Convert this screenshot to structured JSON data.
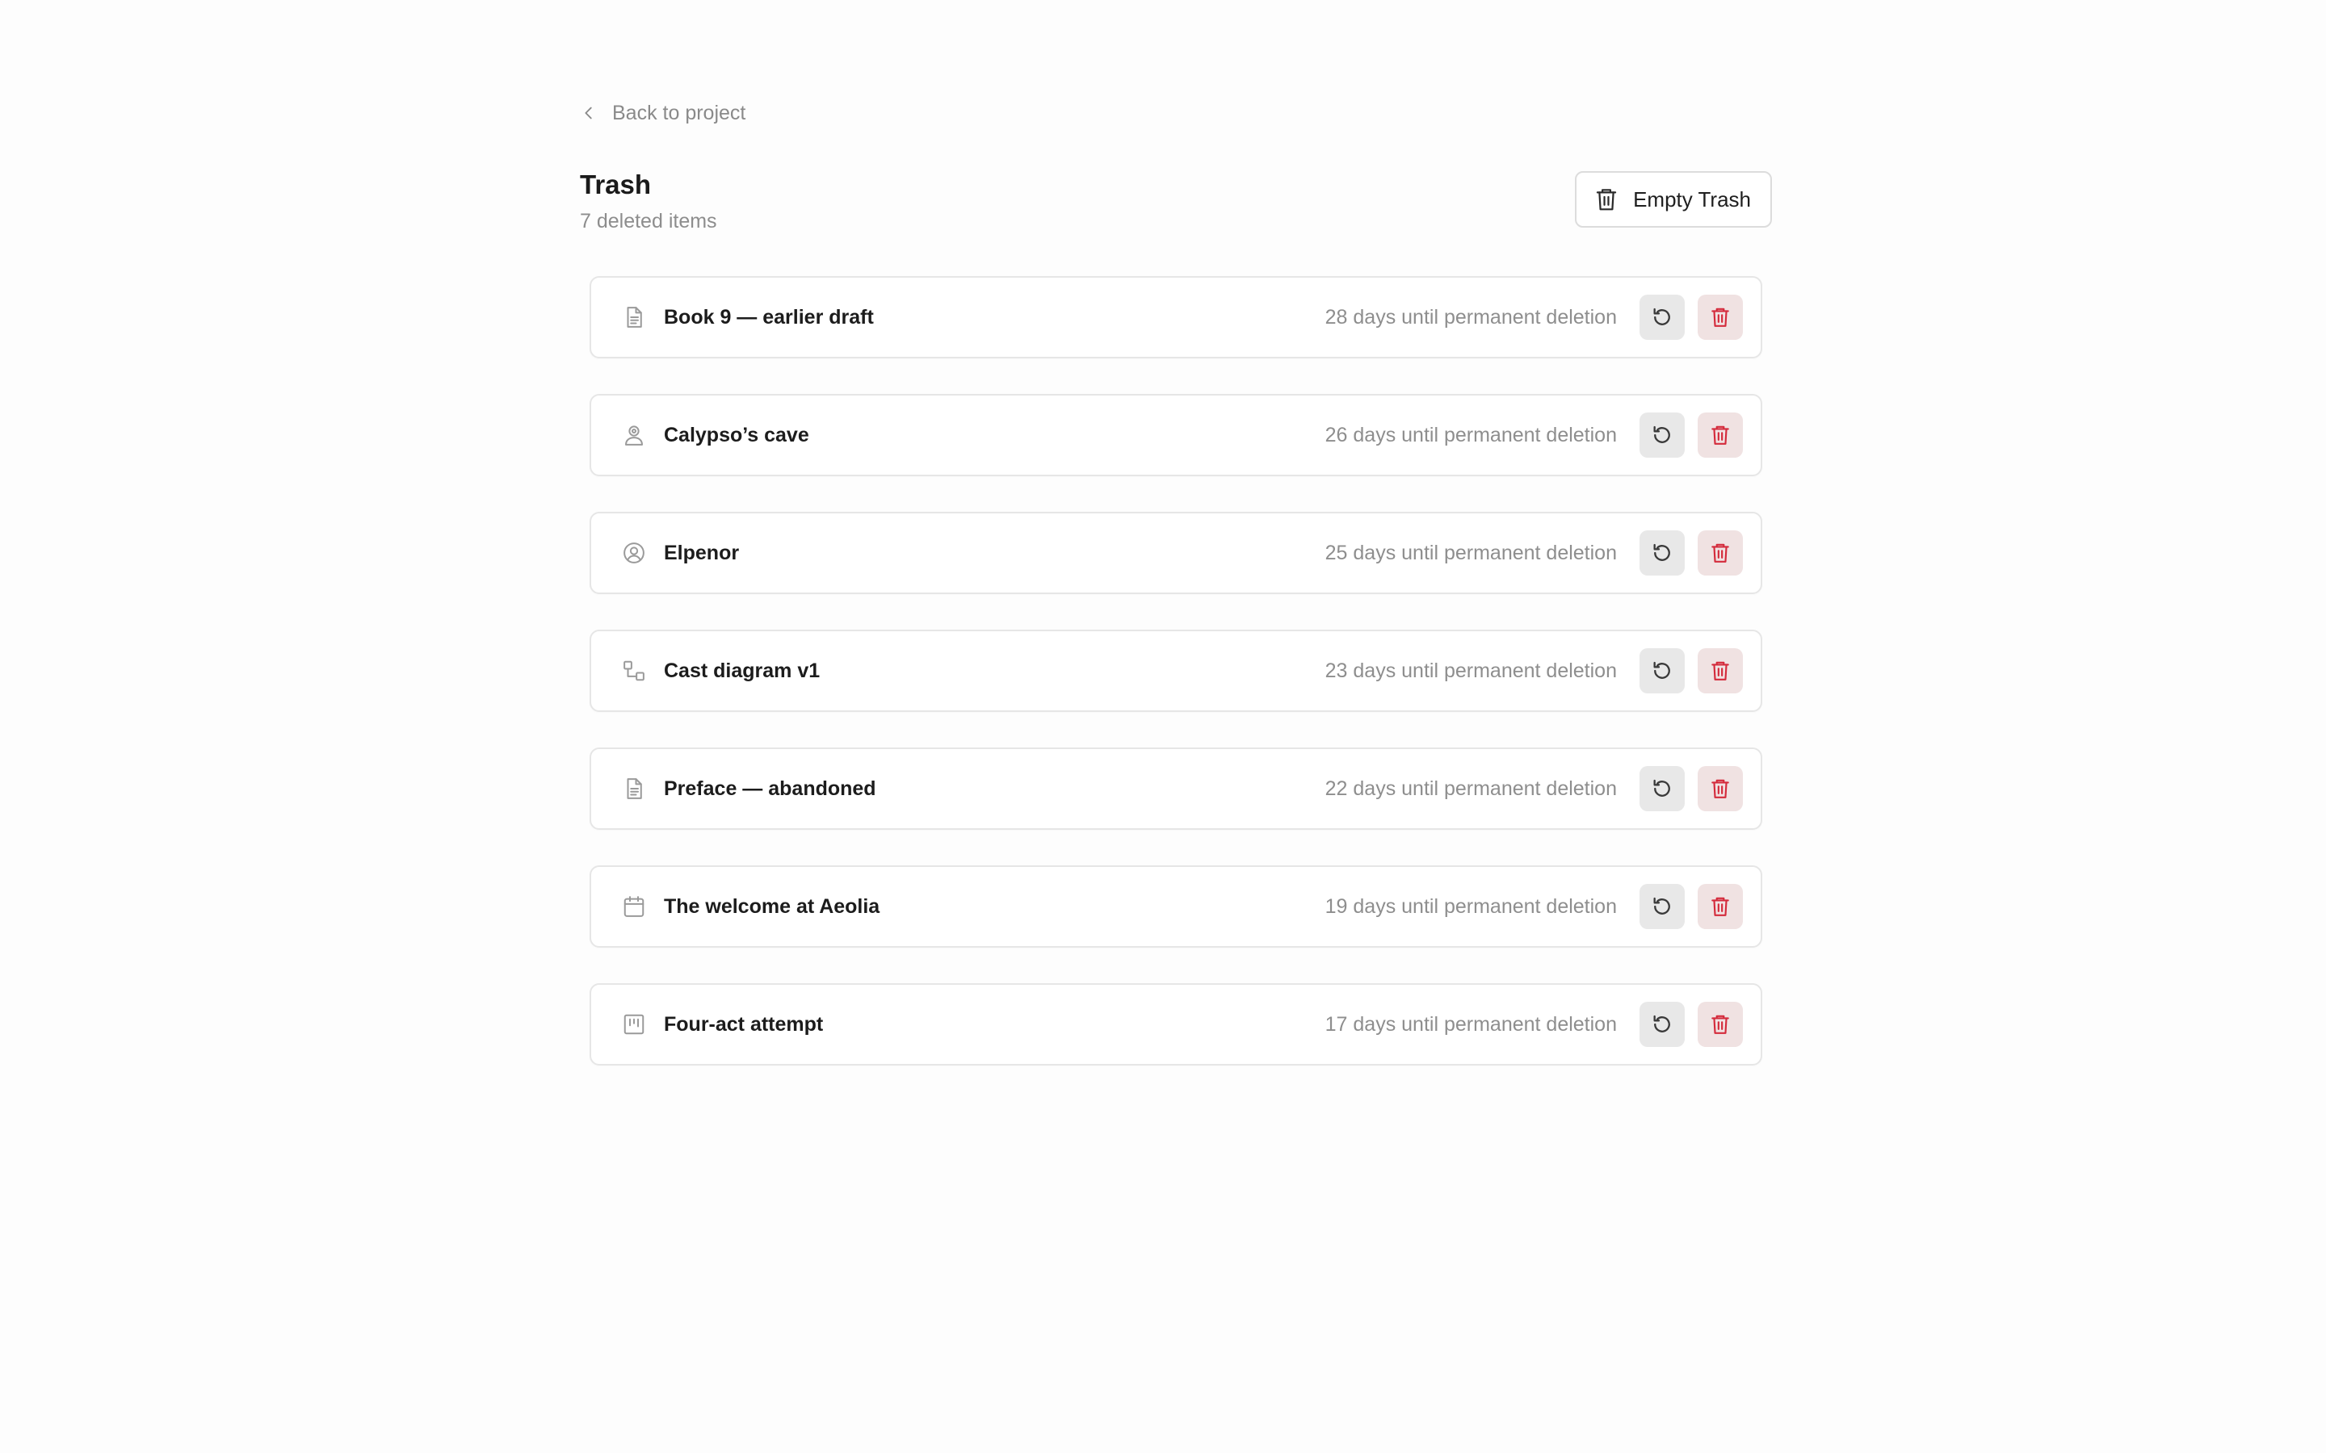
{
  "nav": {
    "back_label": "Back to project"
  },
  "header": {
    "title": "Trash",
    "subtitle": "7 deleted items",
    "empty_button_label": "Empty Trash"
  },
  "colors": {
    "delete_accent": "#d42b3c",
    "restore_icon": "#3a3a3a",
    "muted_text": "#8e8e8e"
  },
  "items": [
    {
      "name": "Book 9 — earlier draft",
      "expiry": "28 days until permanent deletion",
      "icon": "document-icon"
    },
    {
      "name": "Calypso’s cave",
      "expiry": "26 days until permanent deletion",
      "icon": "location-person-icon"
    },
    {
      "name": "Elpenor",
      "expiry": "25 days until permanent deletion",
      "icon": "user-circle-icon"
    },
    {
      "name": "Cast diagram v1",
      "expiry": "23 days until permanent deletion",
      "icon": "diagram-icon"
    },
    {
      "name": "Preface — abandoned",
      "expiry": "22 days until permanent deletion",
      "icon": "document-icon"
    },
    {
      "name": "The welcome at Aeolia",
      "expiry": "19 days until permanent deletion",
      "icon": "calendar-icon"
    },
    {
      "name": "Four-act attempt",
      "expiry": "17 days until permanent deletion",
      "icon": "board-icon"
    }
  ]
}
